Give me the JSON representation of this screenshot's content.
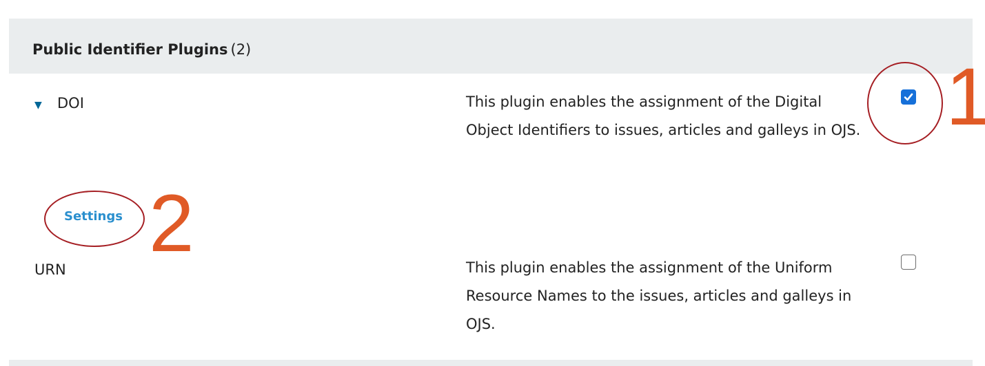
{
  "panel": {
    "header": {
      "title": "Public Identifier Plugins",
      "count": "(2)"
    }
  },
  "plugins": [
    {
      "name": "DOI",
      "expanded": true,
      "toggle_icon": "triangle-down-icon",
      "description": "This plugin enables the assignment of the Digital Object Identifiers to issues, articles and galleys in OJS.",
      "enabled": true,
      "action_label": "Settings"
    },
    {
      "name": "URN",
      "expanded": false,
      "description": "This plugin enables the assignment of the Uniform Resource Names to the issues, articles and galleys in OJS.",
      "enabled": false
    }
  ],
  "annotations": [
    {
      "number": "1",
      "target": "doi-enable-checkbox"
    },
    {
      "number": "2",
      "target": "doi-settings-link"
    }
  ],
  "colors": {
    "header_bg": "#eaedee",
    "link": "#2a8fce",
    "toggle": "#006798",
    "checkbox_checked": "#1670d9",
    "annotation_circle": "#a51e23",
    "annotation_number": "#e05a26"
  }
}
